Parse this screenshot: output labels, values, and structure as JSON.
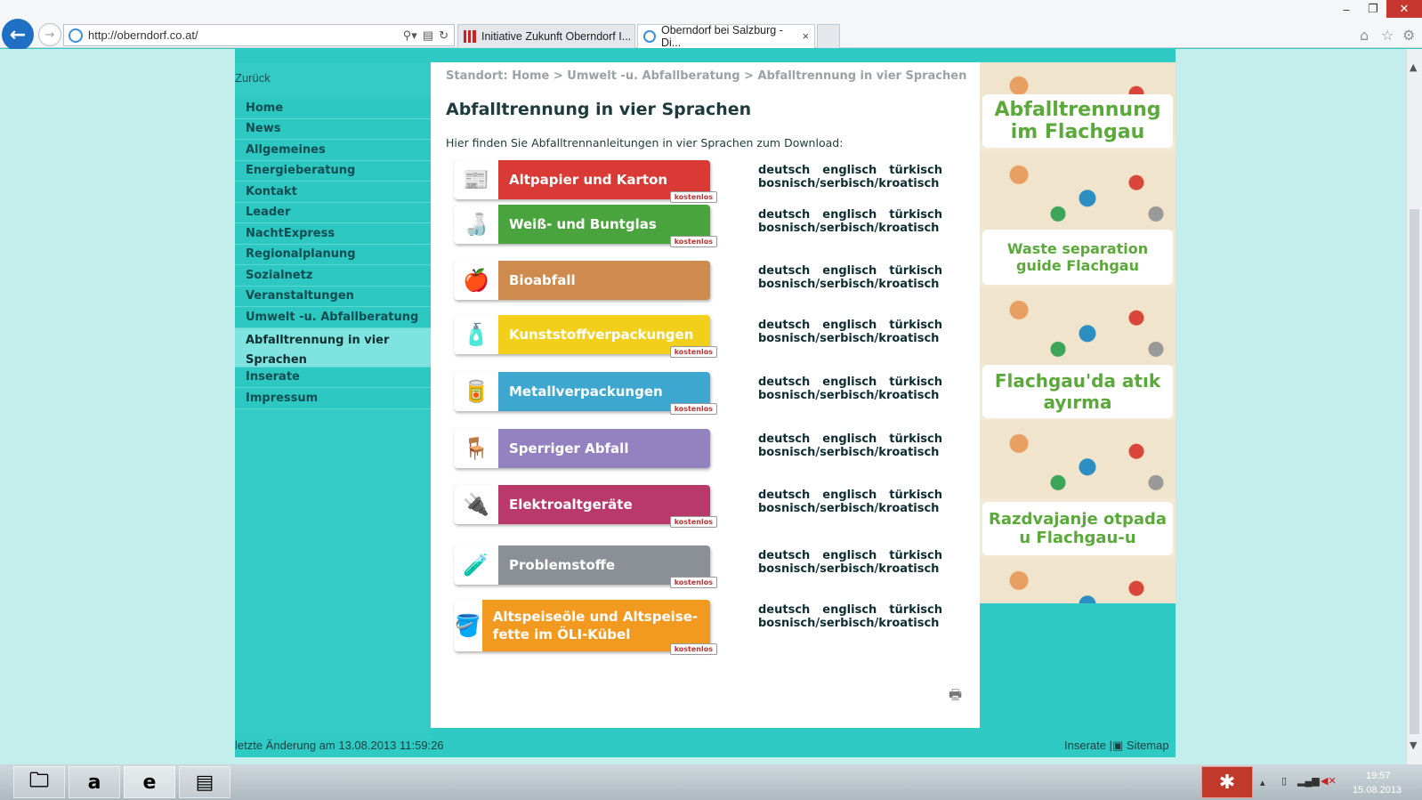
{
  "browser": {
    "url": "http://oberndorf.co.at/",
    "tabs": [
      "Initiative Zukunft Oberndorf I...",
      "Oberndorf bei Salzburg - Di..."
    ],
    "tab_close": "×"
  },
  "sidebar": {
    "back_label": "Zurück",
    "items": [
      "Home",
      "News",
      "Allgemeines",
      "Energieberatung",
      "Kontakt",
      "Leader",
      "NachtExpress",
      "Regionalplanung",
      "Sozialnetz",
      "Veranstaltungen",
      "Umwelt -u. Abfallberatung",
      "Abfalltrennung in vier Sprachen",
      "Inserate",
      "Impressum"
    ]
  },
  "main": {
    "breadcrumb": "Standort: Home > Umwelt -u. Abfallberatung > Abfalltrennung in vier Sprachen",
    "title": "Abfalltrennung in vier Sprachen",
    "intro": "Hier finden Sie Abfalltrennanleitungen in vier Sprachen zum Download:",
    "languages": [
      "deutsch",
      "englisch",
      "türkisch",
      "bosnisch/serbisch/kroatisch"
    ],
    "badge": "kostenlos",
    "categories": [
      {
        "label": "Altpapier und Karton",
        "color": "#d93a35",
        "badge": true
      },
      {
        "label": "Weiß- und Buntglas",
        "color": "#4aa43e",
        "badge": true
      },
      {
        "label": "Bioabfall",
        "color": "#cf8a4d",
        "badge": false
      },
      {
        "label": "Kunststoffverpackungen",
        "color": "#f1cf1a",
        "badge": true
      },
      {
        "label": "Metallverpackungen",
        "color": "#3ea7d0",
        "badge": true
      },
      {
        "label": "Sperriger Abfall",
        "color": "#9481c0",
        "badge": false
      },
      {
        "label": "Elektroaltgeräte",
        "color": "#b93a6a",
        "badge": true
      },
      {
        "label": "Problemstoffe",
        "color": "#8b8f96",
        "badge": true
      },
      {
        "label": "Altspeiseöle und Altspeise-fette im ÖLI-Kübel",
        "color": "#f29a1f",
        "badge": true
      }
    ]
  },
  "ad": {
    "titles": [
      "Abfalltrennung im Flachgau",
      "Waste separation guide Flachgau",
      "Flachgau'da atık ayırma",
      "Razdvajanje otpada u Flachgau-u"
    ]
  },
  "footer": {
    "last_change": "letzte Änderung am 13.08.2013 11:59:26",
    "links": [
      "Inserate",
      "Sitemap"
    ]
  },
  "taskbar": {
    "time": "19:57",
    "date": "15.08.2013"
  },
  "icons": [
    "back-arrow-icon",
    "forward-arrow-icon",
    "ie-icon",
    "search-icon",
    "refresh-icon",
    "home-icon",
    "star-icon",
    "gear-icon",
    "print-icon"
  ]
}
